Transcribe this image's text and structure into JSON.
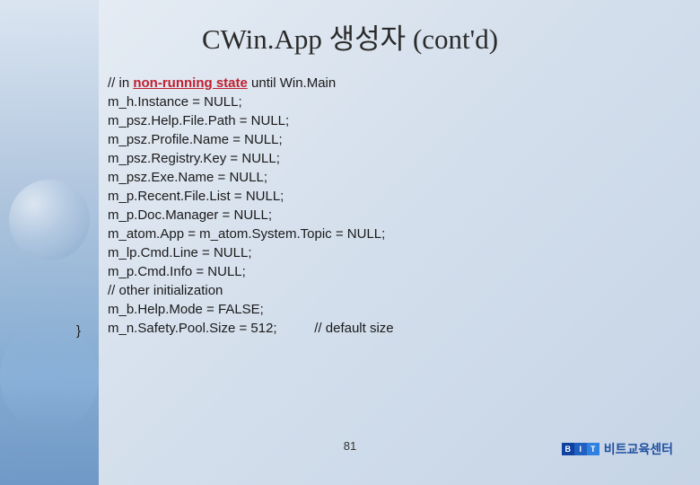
{
  "title": "CWin.App 생성자 (cont'd)",
  "code": {
    "comment_prefix": "// in ",
    "comment_highlight": "non-running state",
    "comment_suffix": " until Win.Main",
    "lines": [
      "m_h.Instance = NULL;",
      "m_psz.Help.File.Path = NULL;",
      "m_psz.Profile.Name = NULL;",
      "m_psz.Registry.Key = NULL;",
      "m_psz.Exe.Name = NULL;",
      "m_p.Recent.File.List = NULL;",
      "m_p.Doc.Manager = NULL;",
      "m_atom.App = m_atom.System.Topic = NULL;",
      "m_lp.Cmd.Line = NULL;",
      "m_p.Cmd.Info = NULL;",
      "// other initialization",
      "m_b.Help.Mode = FALSE;",
      "m_n.Safety.Pool.Size = 512;          // default size"
    ],
    "closing": "}"
  },
  "page_number": "81",
  "brand": {
    "b": "B",
    "i": "I",
    "t": "T",
    "text": "비트교육센터"
  }
}
